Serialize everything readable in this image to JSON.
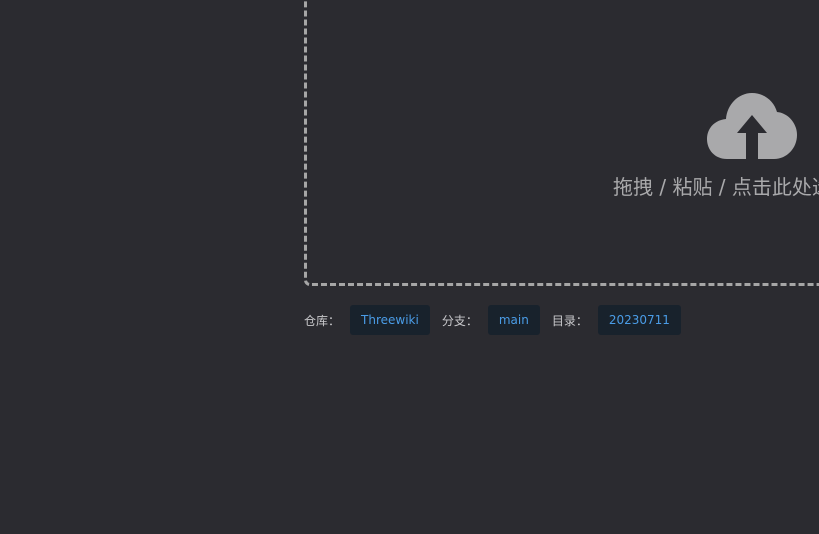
{
  "dropzone": {
    "text": "拖拽 / 粘贴 / 点击此处选",
    "icon": "cloud-upload-icon",
    "border_color": "#a6a6a6",
    "icon_color": "#a9a9ab"
  },
  "meta": {
    "repo_label": "仓库：",
    "repo_value": "Threewiki",
    "branch_label": "分支：",
    "branch_value": "main",
    "dir_label": "目录：",
    "dir_value": "20230711"
  },
  "colors": {
    "background": "#2b2b30",
    "tag_bg": "#18222c",
    "tag_text": "#4a9ce6"
  }
}
